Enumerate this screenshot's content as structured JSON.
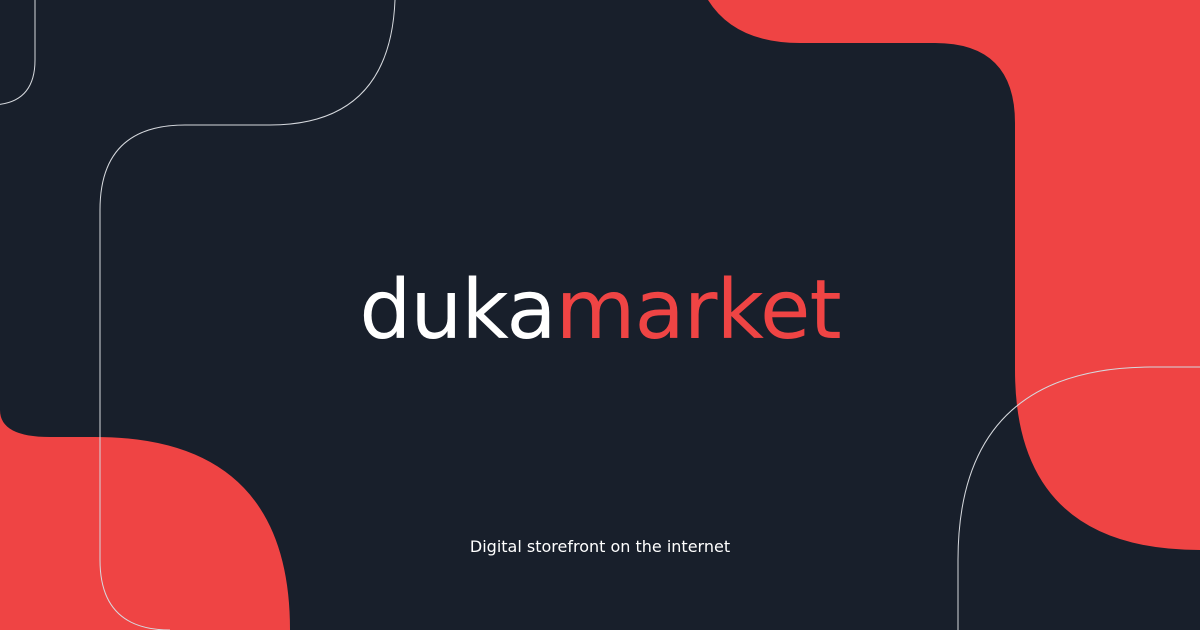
{
  "brand": {
    "word_primary": "duka",
    "word_accent": "market"
  },
  "tagline": "Digital storefront on the internet",
  "colors": {
    "background": "#181f2b",
    "accent": "#ef4444",
    "text": "#ffffff",
    "outline": "#d6d9de"
  }
}
